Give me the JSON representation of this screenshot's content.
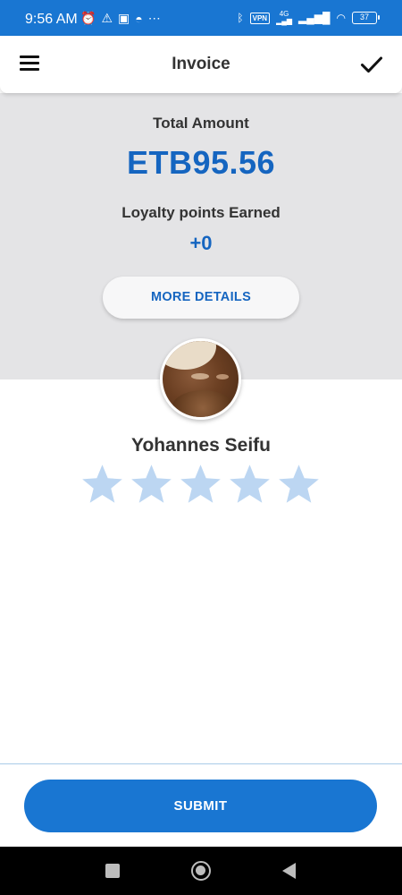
{
  "status_bar": {
    "time": "9:56 AM",
    "left_icons": [
      "alarm-icon",
      "warning-icon",
      "app-icon",
      "app-icon",
      "more-dots-icon"
    ],
    "vpn_label": "VPN",
    "network_label": "4G",
    "battery_level": "37"
  },
  "app_bar": {
    "title": "Invoice"
  },
  "summary": {
    "total_label": "Total Amount",
    "total_amount": "ETB95.56",
    "loyalty_label": "Loyalty points Earned",
    "loyalty_value": "+0",
    "more_details_label": "MORE DETAILS"
  },
  "driver": {
    "name": "Yohannes Seifu",
    "rating": {
      "selected": 0,
      "max": 5
    }
  },
  "actions": {
    "submit_label": "SUBMIT"
  },
  "colors": {
    "primary": "#1976d2",
    "accent_text": "#1565c0",
    "panel_bg": "#e4e4e6",
    "star_inactive": "#bcd6f2"
  }
}
